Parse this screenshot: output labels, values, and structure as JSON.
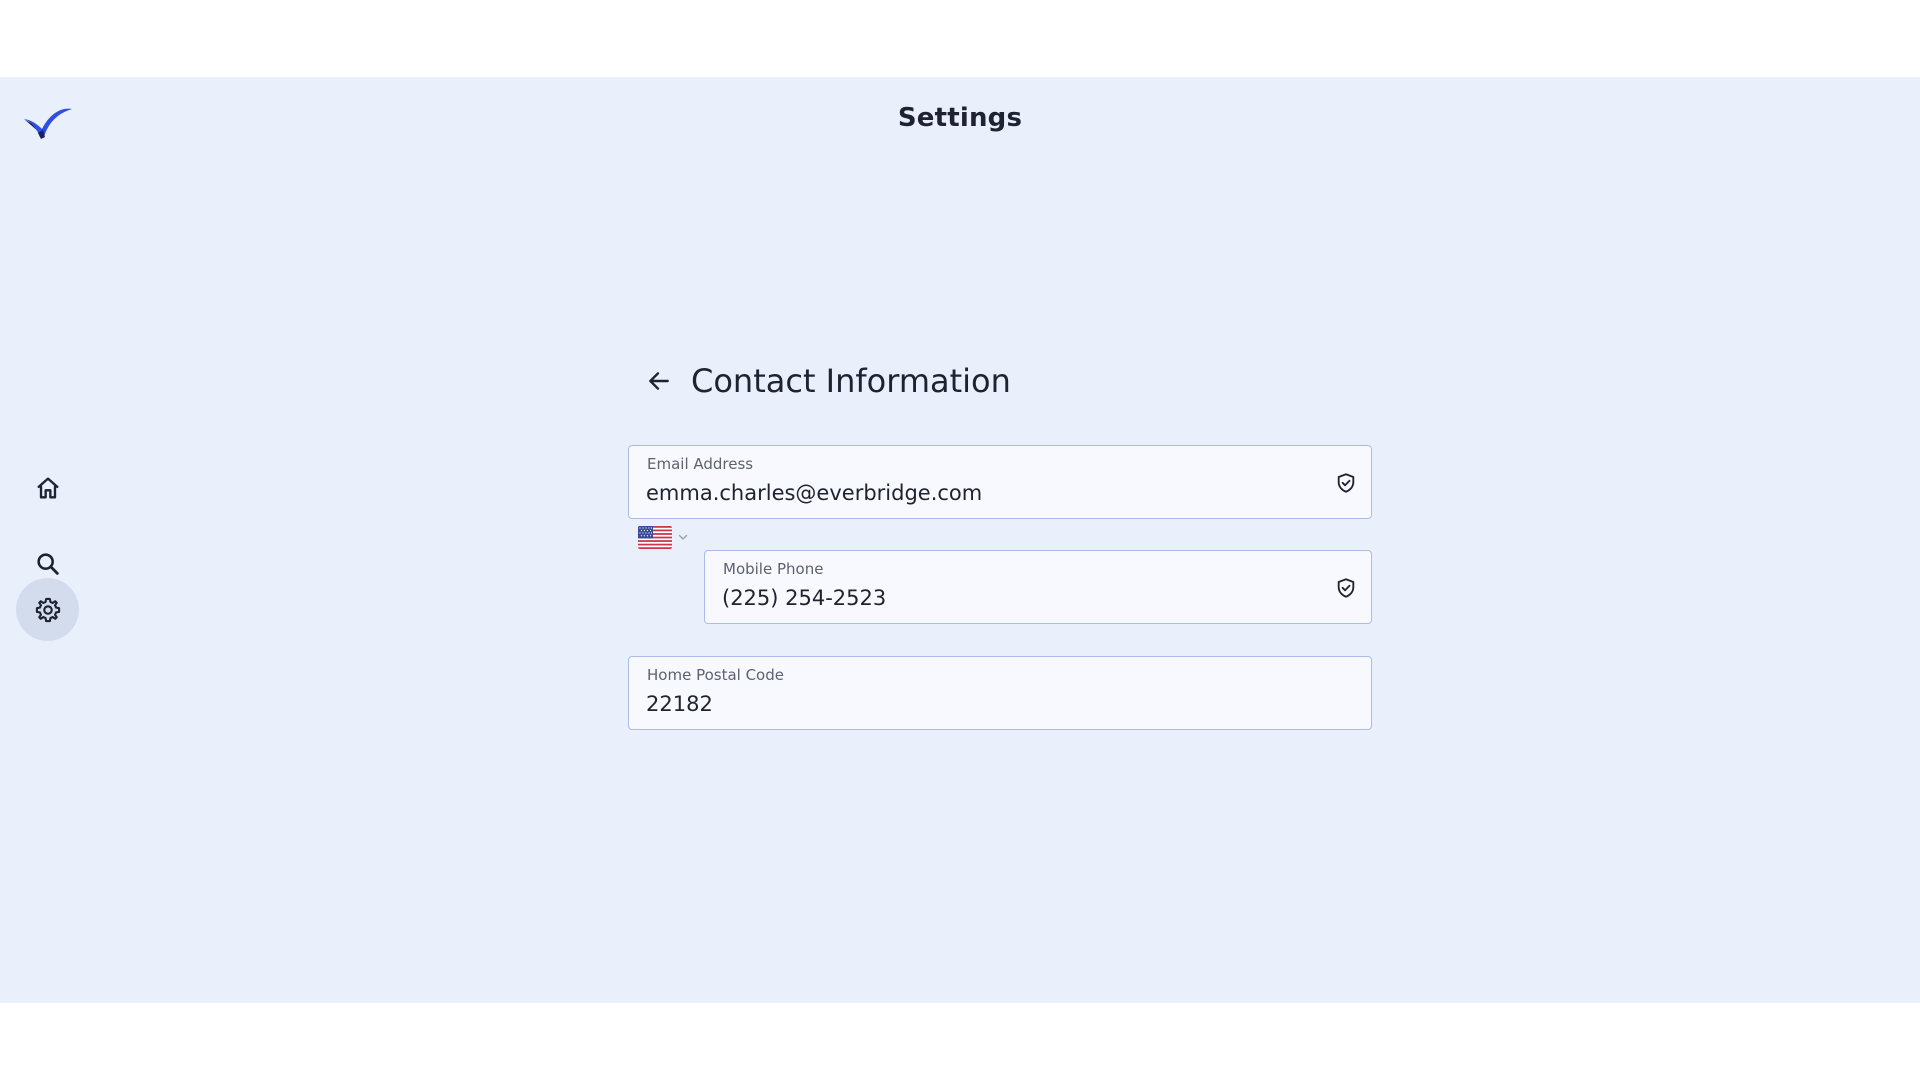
{
  "header": {
    "title": "Settings"
  },
  "sidebar": {
    "items": [
      {
        "name": "home",
        "icon": "home-icon",
        "active": false
      },
      {
        "name": "search",
        "icon": "search-icon",
        "active": false
      },
      {
        "name": "settings",
        "icon": "gear-icon",
        "active": true
      }
    ]
  },
  "section": {
    "title": "Contact Information",
    "back_icon": "arrow-left-icon"
  },
  "fields": {
    "email": {
      "label": "Email Address",
      "value": "emma.charles@everbridge.com",
      "verified_icon": "shield-check-icon"
    },
    "phone": {
      "country_flag": "us-flag-icon",
      "label": "Mobile Phone",
      "value": "(225) 254-2523",
      "verified_icon": "shield-check-icon"
    },
    "postal": {
      "label": "Home Postal Code",
      "value": "22182"
    }
  },
  "colors": {
    "app_background": "#e9effb",
    "field_border": "#a9bde9",
    "brand_primary": "#2f4fe0",
    "brand_dark": "#18225c"
  }
}
